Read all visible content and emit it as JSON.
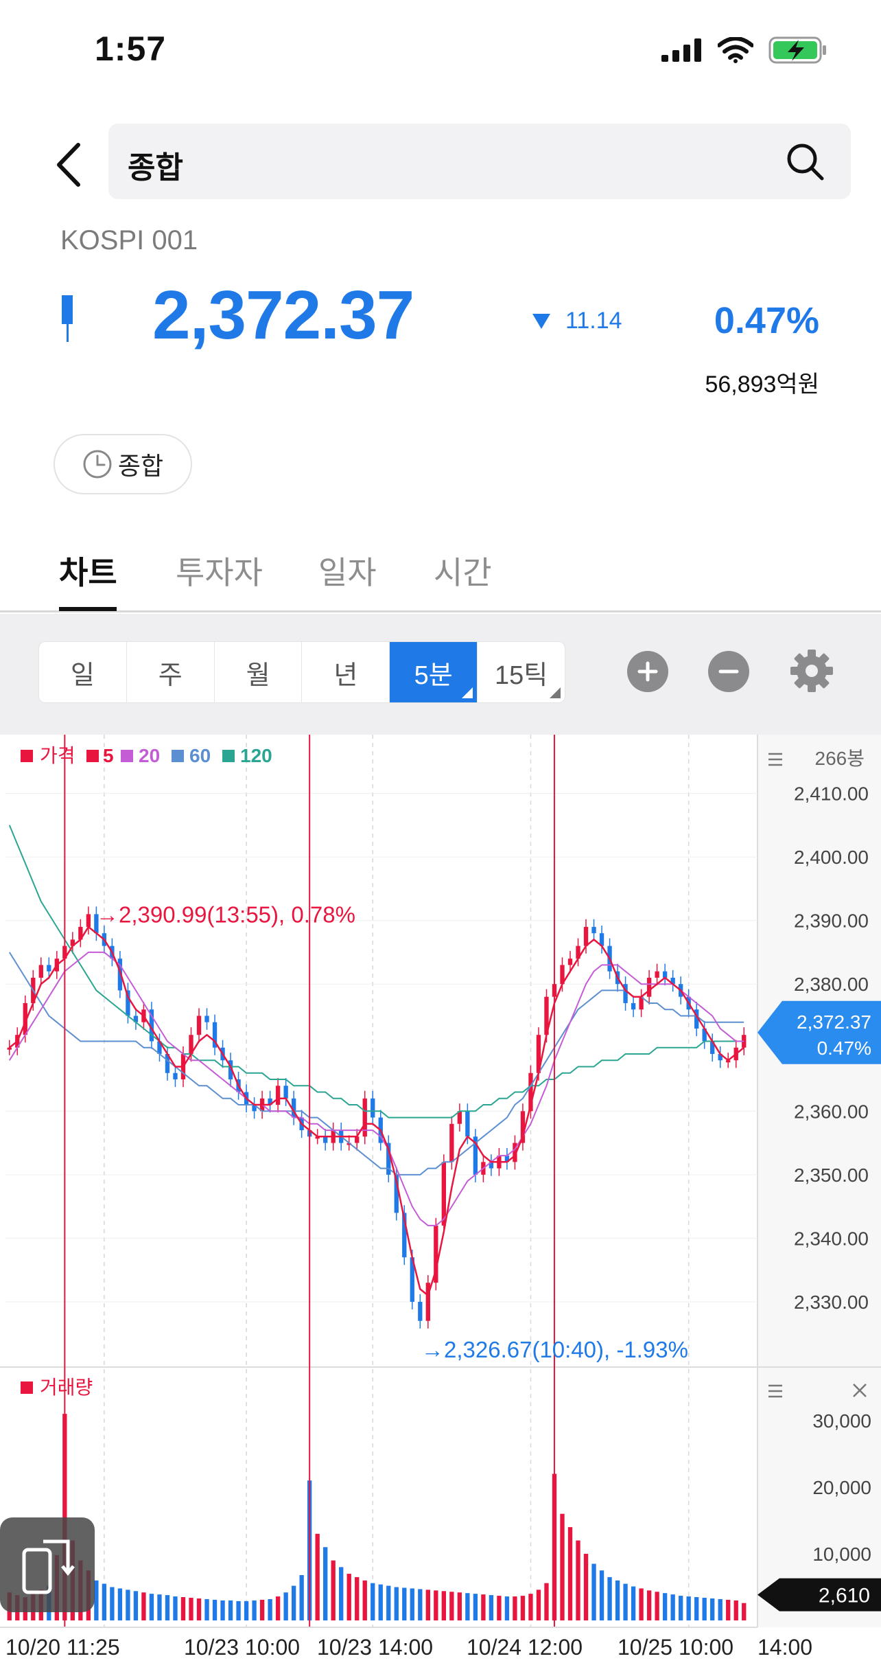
{
  "status": {
    "time": "1:57"
  },
  "search": {
    "query": "종합"
  },
  "index": {
    "code": "KOSPI 001",
    "price": "2,372.37",
    "change": "11.14",
    "change_pct": "0.47%",
    "amount": "56,893억원",
    "chip_label": "종합"
  },
  "tabs": [
    {
      "label": "차트"
    },
    {
      "label": "투자자"
    },
    {
      "label": "일자"
    },
    {
      "label": "시간"
    }
  ],
  "periods": [
    {
      "label": "일"
    },
    {
      "label": "주"
    },
    {
      "label": "월"
    },
    {
      "label": "년"
    },
    {
      "label": "5분"
    },
    {
      "label": "15틱"
    }
  ],
  "colors": {
    "accent": "#1f7ae8",
    "up": "#e8163f",
    "down": "#1f7ae8",
    "ma5": "#e8163f",
    "ma20": "#c45cd6",
    "ma60": "#5b8fd1",
    "ma120": "#2aa592"
  },
  "chart_data": {
    "type": "line",
    "legend": [
      {
        "label": "가격",
        "color": "#e8163f"
      },
      {
        "label": "5",
        "color": "#e8163f"
      },
      {
        "label": "20",
        "color": "#c45cd6"
      },
      {
        "label": "60",
        "color": "#5b8fd1"
      },
      {
        "label": "120",
        "color": "#2aa592"
      }
    ],
    "bar_count": "266봉",
    "ylim": [
      2322,
      2416
    ],
    "y_ticks": [
      "2,410.00",
      "2,400.00",
      "2,390.00",
      "2,380.00",
      "2,360.00",
      "2,350.00",
      "2,340.00",
      "2,330.00"
    ],
    "y_tick_values": [
      2410,
      2400,
      2390,
      2380,
      2360,
      2350,
      2340,
      2330
    ],
    "current_price": {
      "value": 2372.37,
      "label": "2,372.37",
      "pct": "0.47%"
    },
    "high_annotation": {
      "value": 2390.99,
      "label": "2,390.99(13:55), 0.78%"
    },
    "low_annotation": {
      "value": 2326.67,
      "label": "2,326.67(10:40), -1.93%"
    },
    "x_ticks": [
      "10/20 11:25",
      "10/23 10:00",
      "10/23 14:00",
      "10/24 12:00",
      "10/25 10:00",
      "14:00"
    ],
    "price_series": [
      2370,
      2372,
      2377,
      2381,
      2383,
      2382,
      2384,
      2386,
      2387,
      2389,
      2391,
      2388,
      2386,
      2384,
      2379,
      2375,
      2374,
      2376,
      2371,
      2369,
      2366,
      2365,
      2369,
      2372,
      2375,
      2374,
      2370,
      2368,
      2365,
      2363,
      2361,
      2360,
      2362,
      2361,
      2364,
      2362,
      2359,
      2357,
      2356,
      2356,
      2355,
      2357,
      2355,
      2355,
      2356,
      2362,
      2359,
      2355,
      2350,
      2344,
      2337,
      2330,
      2327,
      2333,
      2342,
      2352,
      2358,
      2360,
      2356,
      2350,
      2352,
      2351,
      2353,
      2352,
      2355,
      2360,
      2366,
      2372,
      2378,
      2380,
      2383,
      2384,
      2386,
      2389,
      2388,
      2386,
      2382,
      2380,
      2377,
      2376,
      2378,
      2381,
      2382,
      2381,
      2380,
      2378,
      2376,
      2373,
      2371,
      2369,
      2368,
      2368,
      2370,
      2372
    ],
    "ma5": [
      2370,
      2371,
      2374,
      2377,
      2380,
      2381,
      2383,
      2384,
      2386,
      2387,
      2389,
      2388,
      2387,
      2385,
      2382,
      2378,
      2376,
      2375,
      2373,
      2371,
      2369,
      2367,
      2367,
      2369,
      2371,
      2372,
      2371,
      2369,
      2367,
      2364,
      2362,
      2361,
      2361,
      2361,
      2362,
      2362,
      2360,
      2358,
      2357,
      2356,
      2356,
      2356,
      2356,
      2356,
      2356,
      2358,
      2358,
      2357,
      2354,
      2349,
      2343,
      2337,
      2332,
      2331,
      2335,
      2341,
      2348,
      2354,
      2356,
      2355,
      2353,
      2352,
      2352,
      2352,
      2353,
      2356,
      2361,
      2366,
      2372,
      2377,
      2380,
      2382,
      2384,
      2386,
      2387,
      2386,
      2384,
      2381,
      2379,
      2378,
      2378,
      2379,
      2380,
      2381,
      2380,
      2379,
      2377,
      2375,
      2373,
      2371,
      2369,
      2368,
      2369,
      2370
    ],
    "ma20": [
      2368,
      2370,
      2372,
      2374,
      2376,
      2378,
      2380,
      2382,
      2383,
      2384,
      2385,
      2385,
      2385,
      2384,
      2383,
      2381,
      2379,
      2377,
      2375,
      2373,
      2371,
      2370,
      2369,
      2368,
      2368,
      2367,
      2366,
      2365,
      2364,
      2363,
      2362,
      2361,
      2361,
      2360,
      2360,
      2360,
      2359,
      2359,
      2358,
      2358,
      2357,
      2357,
      2357,
      2357,
      2357,
      2357,
      2357,
      2356,
      2354,
      2351,
      2348,
      2345,
      2343,
      2342,
      2342,
      2343,
      2345,
      2347,
      2349,
      2350,
      2351,
      2352,
      2353,
      2353,
      2354,
      2356,
      2358,
      2361,
      2364,
      2368,
      2371,
      2374,
      2377,
      2380,
      2382,
      2383,
      2383,
      2383,
      2382,
      2381,
      2380,
      2380,
      2380,
      2380,
      2380,
      2379,
      2378,
      2377,
      2376,
      2375,
      2373,
      2372,
      2371,
      2371
    ],
    "ma60": [
      2385,
      2383,
      2381,
      2379,
      2377,
      2375,
      2374,
      2373,
      2372,
      2371,
      2371,
      2371,
      2371,
      2371,
      2371,
      2371,
      2371,
      2370,
      2370,
      2369,
      2368,
      2367,
      2366,
      2365,
      2364,
      2364,
      2363,
      2362,
      2362,
      2361,
      2361,
      2361,
      2360,
      2360,
      2360,
      2360,
      2360,
      2360,
      2359,
      2359,
      2358,
      2357,
      2356,
      2355,
      2354,
      2353,
      2352,
      2351,
      2351,
      2350,
      2350,
      2350,
      2350,
      2351,
      2351,
      2352,
      2352,
      2353,
      2354,
      2355,
      2356,
      2357,
      2358,
      2359,
      2361,
      2362,
      2364,
      2366,
      2368,
      2370,
      2372,
      2374,
      2376,
      2377,
      2378,
      2379,
      2379,
      2379,
      2379,
      2378,
      2378,
      2377,
      2377,
      2376,
      2376,
      2375,
      2375,
      2375,
      2374,
      2374,
      2374,
      2374,
      2374,
      2374
    ],
    "ma120": [
      2405,
      2402,
      2399,
      2396,
      2393,
      2391,
      2389,
      2387,
      2385,
      2383,
      2381,
      2379,
      2378,
      2377,
      2376,
      2375,
      2374,
      2373,
      2372,
      2371,
      2370,
      2370,
      2369,
      2369,
      2368,
      2368,
      2368,
      2367,
      2367,
      2367,
      2366,
      2366,
      2366,
      2365,
      2365,
      2365,
      2364,
      2364,
      2364,
      2363,
      2363,
      2362,
      2362,
      2361,
      2361,
      2360,
      2360,
      2360,
      2359,
      2359,
      2359,
      2359,
      2359,
      2359,
      2359,
      2359,
      2359,
      2360,
      2360,
      2360,
      2361,
      2361,
      2362,
      2362,
      2363,
      2363,
      2364,
      2364,
      2365,
      2365,
      2366,
      2366,
      2367,
      2367,
      2367,
      2368,
      2368,
      2368,
      2369,
      2369,
      2369,
      2369,
      2370,
      2370,
      2370,
      2370,
      2370,
      2370,
      2371,
      2371,
      2371,
      2371,
      2371,
      2371
    ],
    "volume": {
      "label": "거래량",
      "ylim": [
        0,
        34000
      ],
      "y_ticks": [
        "30,000",
        "20,000",
        "10,000"
      ],
      "y_tick_values": [
        30000,
        20000,
        10000
      ],
      "current": {
        "value": 2610,
        "label": "2,610"
      },
      "values": [
        4200,
        3800,
        3500,
        4100,
        4600,
        5200,
        9800,
        31000,
        12000,
        9000,
        7500,
        6000,
        5500,
        5000,
        4800,
        4600,
        4400,
        4200,
        4000,
        3900,
        3800,
        3600,
        3500,
        3400,
        3300,
        3200,
        3100,
        3000,
        3000,
        2900,
        2900,
        3000,
        3100,
        3200,
        3600,
        4200,
        5200,
        6800,
        21000,
        13000,
        11000,
        9000,
        8000,
        7000,
        6500,
        6000,
        5600,
        5400,
        5200,
        5000,
        4900,
        4800,
        4700,
        4600,
        4500,
        4400,
        4300,
        4200,
        4100,
        4000,
        3900,
        3800,
        3700,
        3600,
        3600,
        3700,
        4000,
        4600,
        5600,
        22000,
        16000,
        14000,
        12000,
        10000,
        8500,
        7500,
        6500,
        6000,
        5500,
        5100,
        4800,
        4500,
        4300,
        4100,
        3900,
        3700,
        3600,
        3500,
        3400,
        3300,
        3200,
        3100,
        3000,
        2610
      ]
    }
  }
}
